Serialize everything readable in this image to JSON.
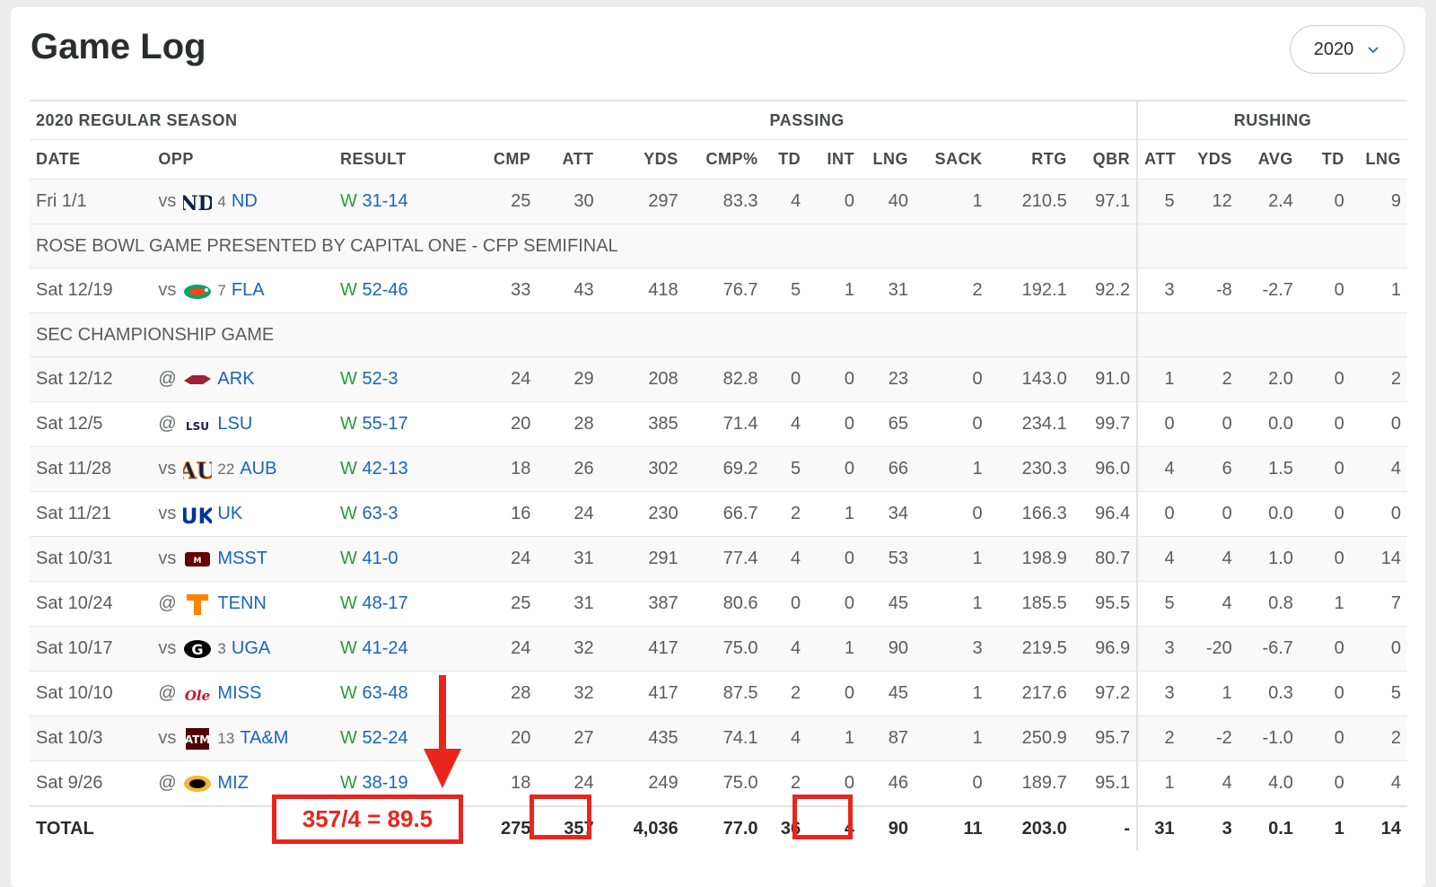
{
  "title": "Game Log",
  "season_select": {
    "value": "2020"
  },
  "group_headers": {
    "season": "2020 REGULAR SEASON",
    "passing": "PASSING",
    "rushing": "RUSHING"
  },
  "columns": [
    "DATE",
    "OPP",
    "RESULT",
    "CMP",
    "ATT",
    "YDS",
    "CMP%",
    "TD",
    "INT",
    "LNG",
    "SACK",
    "RTG",
    "QBR",
    "ATT",
    "YDS",
    "AVG",
    "TD",
    "LNG"
  ],
  "games": [
    {
      "date": "Fri 1/1",
      "ha": "vs",
      "rank": "4",
      "team": "ND",
      "result_wl": "W",
      "score": "31-14",
      "stats": [
        "25",
        "30",
        "297",
        "83.3",
        "4",
        "0",
        "40",
        "1",
        "210.5",
        "97.1",
        "5",
        "12",
        "2.4",
        "0",
        "9"
      ],
      "note": "ROSE BOWL GAME PRESENTED BY CAPITAL ONE - CFP SEMIFINAL",
      "logo": "nd"
    },
    {
      "date": "Sat 12/19",
      "ha": "vs",
      "rank": "7",
      "team": "FLA",
      "result_wl": "W",
      "score": "52-46",
      "stats": [
        "33",
        "43",
        "418",
        "76.7",
        "5",
        "1",
        "31",
        "2",
        "192.1",
        "92.2",
        "3",
        "-8",
        "-2.7",
        "0",
        "1"
      ],
      "note": "SEC CHAMPIONSHIP GAME",
      "logo": "fla"
    },
    {
      "date": "Sat 12/12",
      "ha": "@",
      "rank": "",
      "team": "ARK",
      "result_wl": "W",
      "score": "52-3",
      "stats": [
        "24",
        "29",
        "208",
        "82.8",
        "0",
        "0",
        "23",
        "0",
        "143.0",
        "91.0",
        "1",
        "2",
        "2.0",
        "0",
        "2"
      ],
      "logo": "ark"
    },
    {
      "date": "Sat 12/5",
      "ha": "@",
      "rank": "",
      "team": "LSU",
      "result_wl": "W",
      "score": "55-17",
      "stats": [
        "20",
        "28",
        "385",
        "71.4",
        "4",
        "0",
        "65",
        "0",
        "234.1",
        "99.7",
        "0",
        "0",
        "0.0",
        "0",
        "0"
      ],
      "logo": "lsu"
    },
    {
      "date": "Sat 11/28",
      "ha": "vs",
      "rank": "22",
      "team": "AUB",
      "result_wl": "W",
      "score": "42-13",
      "stats": [
        "18",
        "26",
        "302",
        "69.2",
        "5",
        "0",
        "66",
        "1",
        "230.3",
        "96.0",
        "4",
        "6",
        "1.5",
        "0",
        "4"
      ],
      "logo": "aub"
    },
    {
      "date": "Sat 11/21",
      "ha": "vs",
      "rank": "",
      "team": "UK",
      "result_wl": "W",
      "score": "63-3",
      "stats": [
        "16",
        "24",
        "230",
        "66.7",
        "2",
        "1",
        "34",
        "0",
        "166.3",
        "96.4",
        "0",
        "0",
        "0.0",
        "0",
        "0"
      ],
      "logo": "uk"
    },
    {
      "date": "Sat 10/31",
      "ha": "vs",
      "rank": "",
      "team": "MSST",
      "result_wl": "W",
      "score": "41-0",
      "stats": [
        "24",
        "31",
        "291",
        "77.4",
        "4",
        "0",
        "53",
        "1",
        "198.9",
        "80.7",
        "4",
        "4",
        "1.0",
        "0",
        "14"
      ],
      "logo": "msst"
    },
    {
      "date": "Sat 10/24",
      "ha": "@",
      "rank": "",
      "team": "TENN",
      "result_wl": "W",
      "score": "48-17",
      "stats": [
        "25",
        "31",
        "387",
        "80.6",
        "0",
        "0",
        "45",
        "1",
        "185.5",
        "95.5",
        "5",
        "4",
        "0.8",
        "1",
        "7"
      ],
      "logo": "tenn"
    },
    {
      "date": "Sat 10/17",
      "ha": "vs",
      "rank": "3",
      "team": "UGA",
      "result_wl": "W",
      "score": "41-24",
      "stats": [
        "24",
        "32",
        "417",
        "75.0",
        "4",
        "1",
        "90",
        "3",
        "219.5",
        "96.9",
        "3",
        "-20",
        "-6.7",
        "0",
        "0"
      ],
      "logo": "uga"
    },
    {
      "date": "Sat 10/10",
      "ha": "@",
      "rank": "",
      "team": "MISS",
      "result_wl": "W",
      "score": "63-48",
      "stats": [
        "28",
        "32",
        "417",
        "87.5",
        "2",
        "0",
        "45",
        "1",
        "217.6",
        "97.2",
        "3",
        "1",
        "0.3",
        "0",
        "5"
      ],
      "logo": "miss"
    },
    {
      "date": "Sat 10/3",
      "ha": "vs",
      "rank": "13",
      "team": "TA&M",
      "result_wl": "W",
      "score": "52-24",
      "stats": [
        "20",
        "27",
        "435",
        "74.1",
        "4",
        "1",
        "87",
        "1",
        "250.9",
        "95.7",
        "2",
        "-2",
        "-1.0",
        "0",
        "2"
      ],
      "logo": "tam"
    },
    {
      "date": "Sat 9/26",
      "ha": "@",
      "rank": "",
      "team": "MIZ",
      "result_wl": "W",
      "score": "38-19",
      "stats": [
        "18",
        "24",
        "249",
        "75.0",
        "2",
        "0",
        "46",
        "0",
        "189.7",
        "95.1",
        "1",
        "4",
        "4.0",
        "0",
        "4"
      ],
      "logo": "miz"
    }
  ],
  "total": {
    "label": "TOTAL",
    "stats": [
      "275",
      "357",
      "4,036",
      "77.0",
      "36",
      "4",
      "90",
      "11",
      "203.0",
      "-",
      "31",
      "3",
      "0.1",
      "1",
      "14"
    ]
  },
  "annotation": {
    "text": "357/4 = 89.5",
    "color": "#e8261c"
  },
  "colors": {
    "win": "#2a9b3a",
    "link": "#1763c6",
    "annotation": "#e8261c"
  }
}
